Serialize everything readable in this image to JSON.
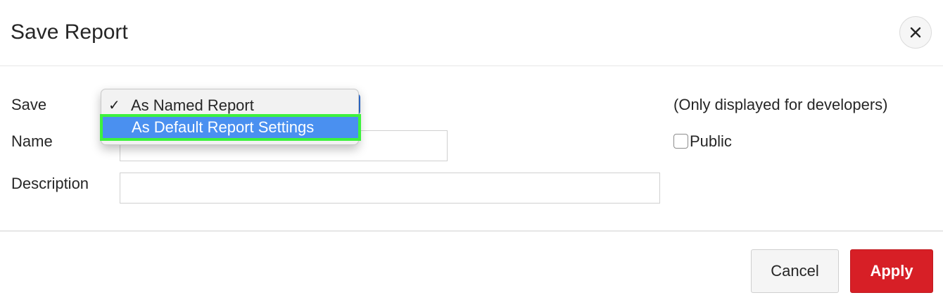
{
  "dialog": {
    "title": "Save Report",
    "close_icon": "close-icon"
  },
  "form": {
    "save_label": "Save",
    "name_label": "Name",
    "description_label": "Description",
    "name_value": "",
    "description_value": "",
    "save_options": [
      {
        "label": "As Named Report",
        "checked": true
      },
      {
        "label": "As Default Report Settings",
        "highlighted": true
      }
    ],
    "developer_note": "(Only displayed for developers)",
    "public_label": "Public",
    "public_checked": false
  },
  "footer": {
    "cancel_label": "Cancel",
    "apply_label": "Apply"
  },
  "colors": {
    "apply_bg": "#d71f26",
    "highlight_bg": "#4a90f0",
    "highlight_outline": "#3df23d"
  }
}
